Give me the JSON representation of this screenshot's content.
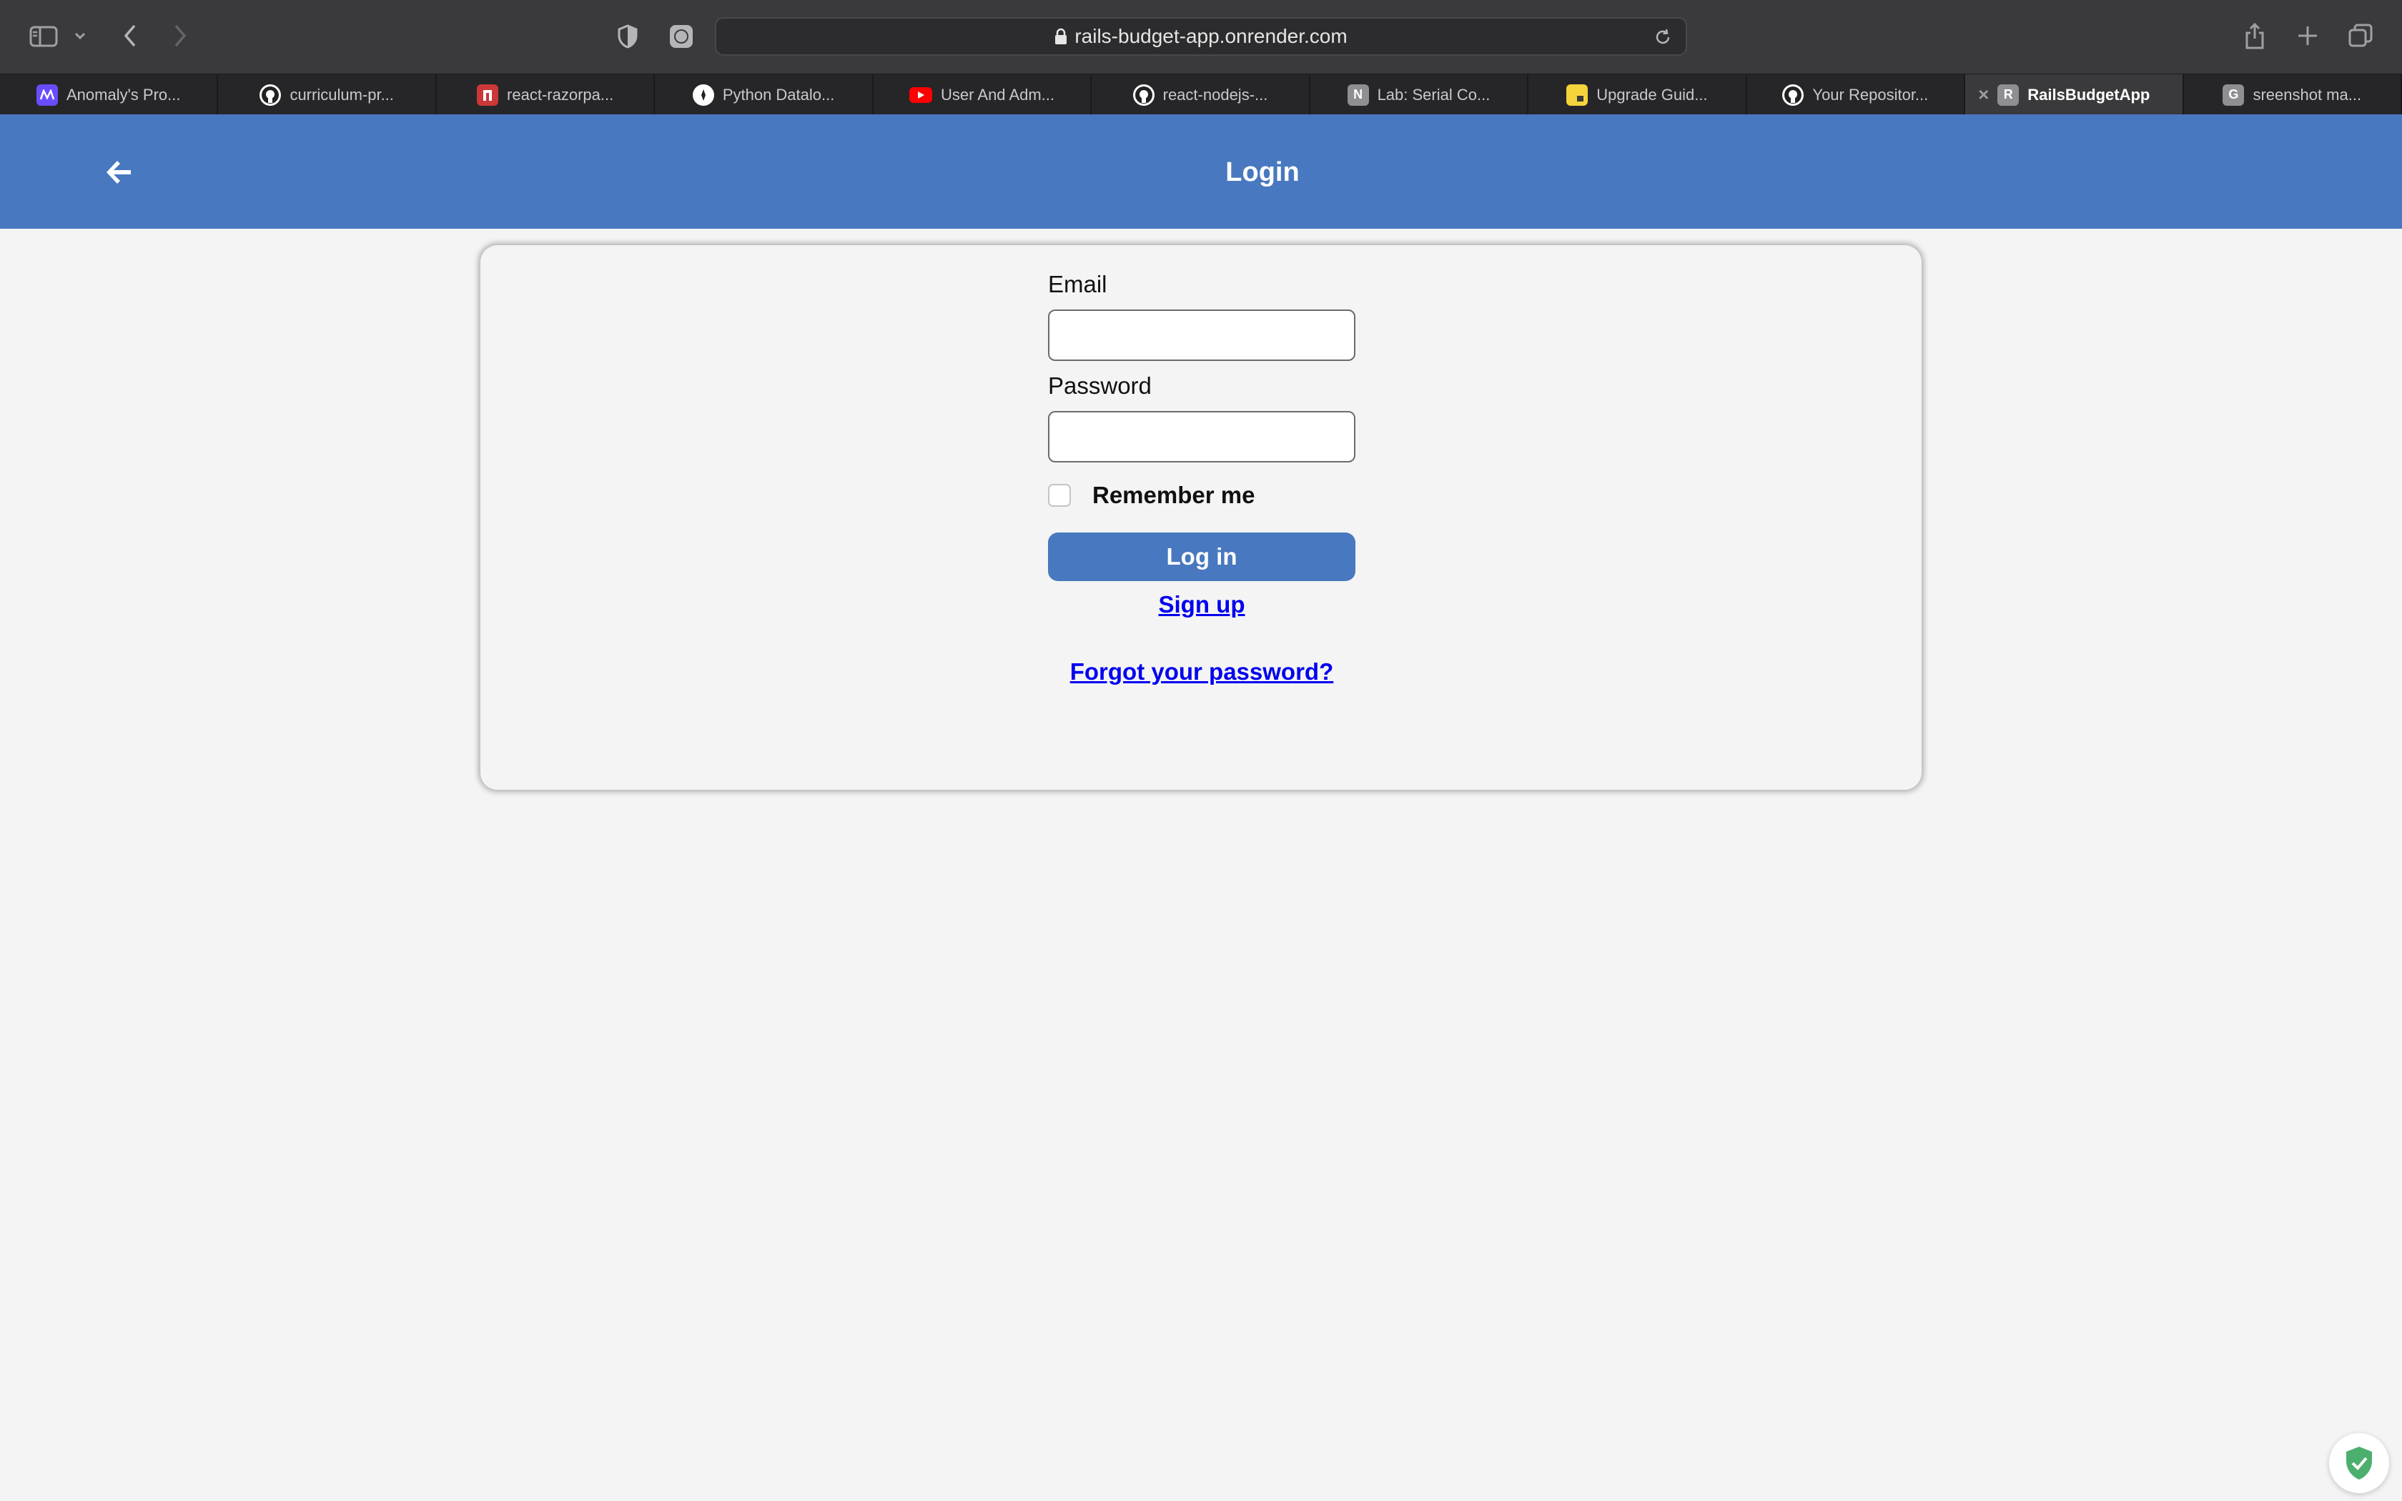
{
  "browser": {
    "url": "rails-budget-app.onrender.com",
    "tabs": [
      {
        "title": "Anomaly's Pro...",
        "favicon": "anomaly-logo",
        "color": "#6a4cff",
        "glyph": "∾"
      },
      {
        "title": "curriculum-pr...",
        "favicon": "github-icon",
        "color": "#ffffff",
        "glyph": ""
      },
      {
        "title": "react-razorpa...",
        "favicon": "npm-icon",
        "color": "#cb3837",
        "glyph": "n"
      },
      {
        "title": "Python Datalo...",
        "favicon": "compass-icon",
        "color": "#ffffff",
        "glyph": "✦"
      },
      {
        "title": "User And Adm...",
        "favicon": "youtube-icon",
        "color": "#ff0000",
        "glyph": "▶"
      },
      {
        "title": "react-nodejs-...",
        "favicon": "github-icon",
        "color": "#ffffff",
        "glyph": ""
      },
      {
        "title": "Lab: Serial Co...",
        "favicon": "letter-n-icon",
        "color": "#8e8e93",
        "glyph": "N"
      },
      {
        "title": "Upgrade Guid...",
        "favicon": "note-icon",
        "color": "#f5d33b",
        "glyph": ""
      },
      {
        "title": "Your Repositor...",
        "favicon": "github-icon",
        "color": "#ffffff",
        "glyph": ""
      },
      {
        "title": "RailsBudgetApp",
        "favicon": "letter-r-icon",
        "color": "#8e8e93",
        "glyph": "R",
        "active": true
      },
      {
        "title": "sreenshot ma...",
        "favicon": "letter-g-icon",
        "color": "#8e8e93",
        "glyph": "G"
      }
    ]
  },
  "header": {
    "title": "Login"
  },
  "form": {
    "email_label": "Email",
    "email_value": "",
    "password_label": "Password",
    "password_value": "",
    "remember_label": "Remember me",
    "remember_checked": false,
    "login_label": "Log in",
    "signup_label": "Sign up",
    "forgot_label": "Forgot your password?"
  },
  "colors": {
    "header_bg": "#4878bf",
    "button_bg": "#4878bf",
    "link": "#0000ee",
    "page_bg": "#f4f4f4"
  }
}
